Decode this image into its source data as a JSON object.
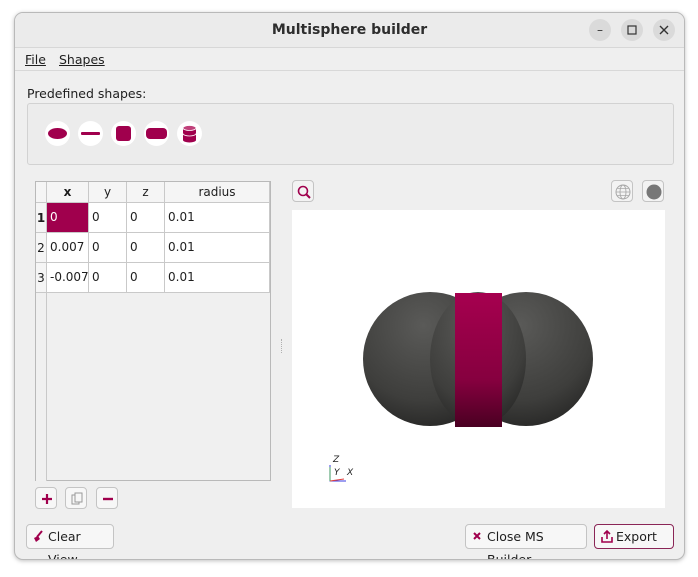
{
  "window": {
    "title": "Multisphere builder"
  },
  "menu": {
    "file": {
      "label": "File"
    },
    "shapes": {
      "label": "Shapes"
    }
  },
  "predefined": {
    "label": "Predefined shapes:",
    "shapes": [
      "ellipsoid-icon",
      "line-icon",
      "rounded-square-icon",
      "rounded-rect-icon",
      "cylinder-icon"
    ]
  },
  "table": {
    "headers": {
      "x": "x",
      "y": "y",
      "z": "z",
      "radius": "radius"
    },
    "rows": [
      {
        "num": "1",
        "x": "0",
        "y": "0",
        "z": "0",
        "radius": "0.01"
      },
      {
        "num": "2",
        "x": "0.007",
        "y": "0",
        "z": "0",
        "radius": "0.01"
      },
      {
        "num": "3",
        "x": "-0.007",
        "y": "0",
        "z": "0",
        "radius": "0.01"
      }
    ]
  },
  "viewer": {
    "axes": {
      "z": "Z",
      "y": "Y",
      "x": "X"
    }
  },
  "buttons": {
    "clear_view": "Clear View",
    "close_builder": "Close MS Builder",
    "export": "Export"
  },
  "colors": {
    "accent": "#a0004d",
    "sphere": "#4a4a48"
  }
}
